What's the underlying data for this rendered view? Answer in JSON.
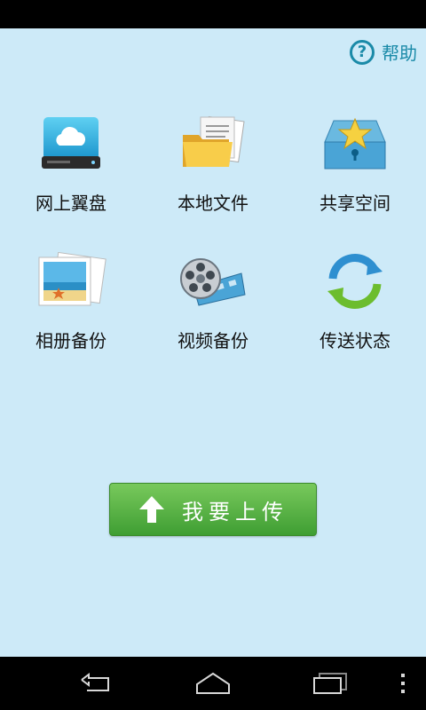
{
  "header": {
    "help_label": "帮助",
    "help_icon": "question-mark-icon"
  },
  "features": [
    {
      "label": "网上翼盘",
      "icon": "cloud-drive-icon"
    },
    {
      "label": "本地文件",
      "icon": "folder-documents-icon"
    },
    {
      "label": "共享空间",
      "icon": "star-box-icon"
    },
    {
      "label": "相册备份",
      "icon": "photo-album-icon"
    },
    {
      "label": "视频备份",
      "icon": "film-reel-icon"
    },
    {
      "label": "传送状态",
      "icon": "sync-arrows-icon"
    }
  ],
  "upload_button": {
    "label": "我要上传",
    "icon": "upload-arrow-icon"
  },
  "colors": {
    "background": "#cdeaf8",
    "accent": "#1a8aa8",
    "button_green": "#4fab3c"
  },
  "nav": {
    "back": "back-icon",
    "home": "home-icon",
    "recents": "recent-apps-icon",
    "menu": "overflow-menu-icon"
  }
}
